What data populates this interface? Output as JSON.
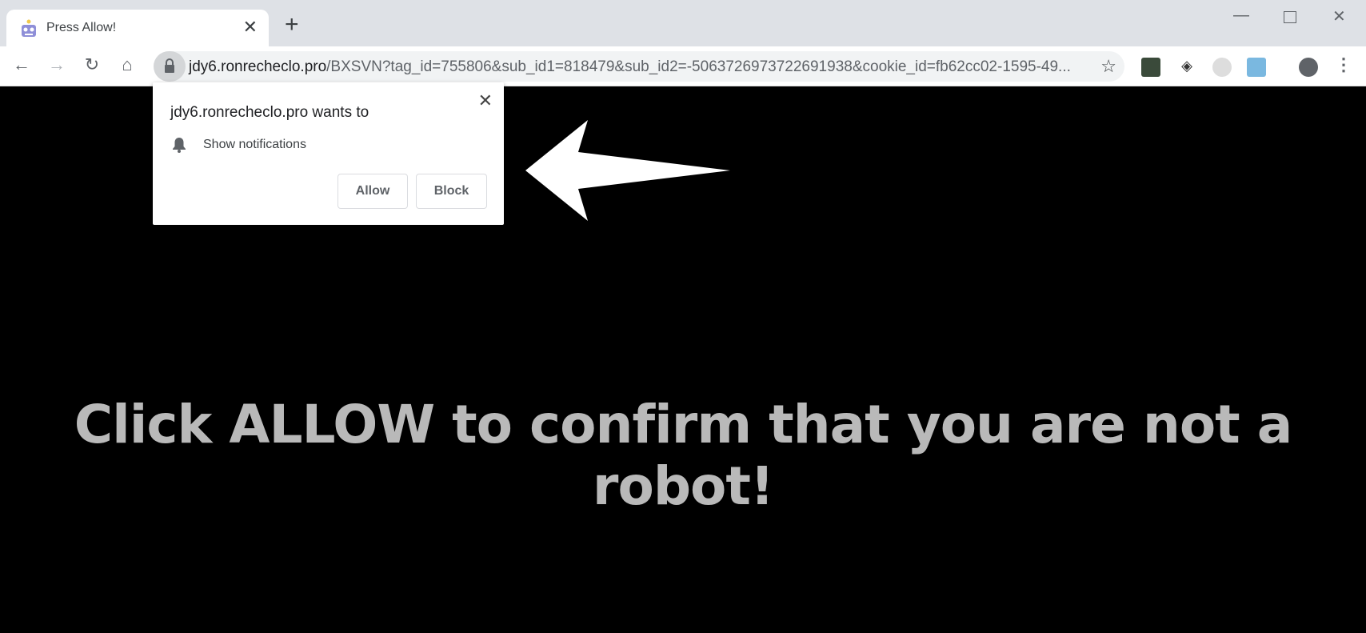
{
  "tab": {
    "title": "Press Allow!",
    "favicon": "robot-icon"
  },
  "window_controls": [
    "minimize",
    "maximize",
    "close"
  ],
  "address_bar": {
    "domain": "jdy6.ronrecheclo.pro",
    "path": "/BXSVN?tag_id=755806&sub_id1=818479&sub_id2=-5063726973722691938&cookie_id=fb62cc02-1595-49..."
  },
  "extensions": [
    "pdf-extension-icon",
    "diamond-extension-icon",
    "globe-extension-icon",
    "tools-extension-icon"
  ],
  "popup": {
    "title": "jdy6.ronrecheclo.pro wants to",
    "permission": "Show notifications",
    "allow_label": "Allow",
    "block_label": "Block"
  },
  "page": {
    "message": "Click ALLOW to confirm that you are not a robot!"
  },
  "colors": {
    "page_bg": "#000000",
    "message": "#b9b9b9",
    "arrow": "#ffffff"
  }
}
